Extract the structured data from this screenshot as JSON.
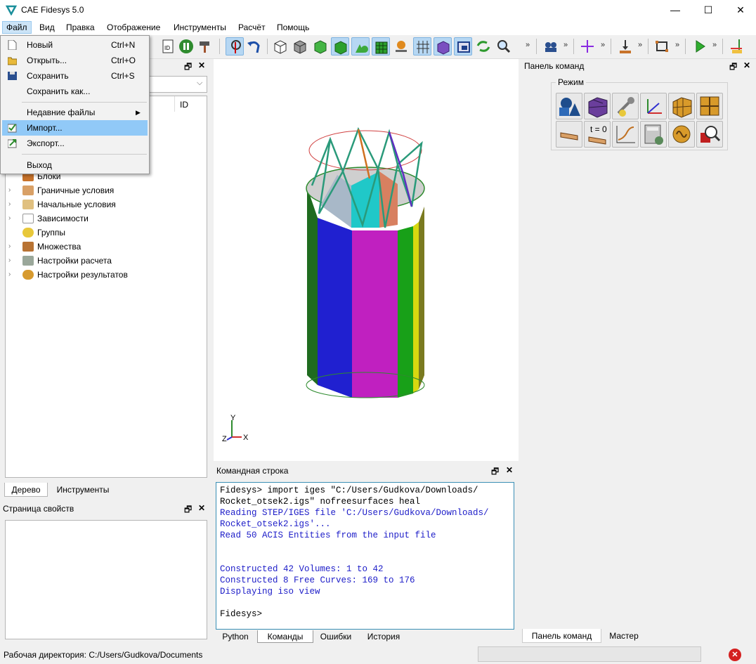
{
  "window": {
    "title": "CAE Fidesys 5.0"
  },
  "menu": [
    "Файл",
    "Вид",
    "Правка",
    "Отображение",
    "Инструменты",
    "Расчёт",
    "Помощь"
  ],
  "file_menu": {
    "items": [
      {
        "label": "Новый",
        "shortcut": "Ctrl+N"
      },
      {
        "label": "Открыть...",
        "shortcut": "Ctrl+O"
      },
      {
        "label": "Сохранить",
        "shortcut": "Ctrl+S"
      },
      {
        "label": "Сохранить как...",
        "shortcut": ""
      },
      {
        "label": "Недавние файлы",
        "shortcut": ""
      },
      {
        "label": "Импорт...",
        "shortcut": ""
      },
      {
        "label": "Экспорт...",
        "shortcut": ""
      },
      {
        "label": "Выход",
        "shortcut": ""
      }
    ],
    "highlighted": "Импорт..."
  },
  "tree": {
    "column_id": "ID",
    "items": [
      "Блоки",
      "Граничные условия",
      "Начальные условия",
      "Зависимости",
      "Группы",
      "Множества",
      "Настройки расчета",
      "Настройки результатов"
    ],
    "bottom_tabs": [
      "Дерево",
      "Инструменты"
    ]
  },
  "properties": {
    "title": "Страница свойств"
  },
  "command_panel": {
    "title": "Панель команд",
    "mode_label": "Режим",
    "t0_label": "t = 0",
    "bottom_tabs": [
      "Панель команд",
      "Мастер"
    ]
  },
  "command_line": {
    "title": "Командная строка",
    "lines": [
      {
        "text": "Fidesys> import iges \"C:/Users/Gudkova/Downloads/",
        "style": "blk"
      },
      {
        "text": "Rocket_otsek2.igs\" nofreesurfaces heal",
        "style": "blk"
      },
      {
        "text": "Reading STEP/IGES file 'C:/Users/Gudkova/Downloads/",
        "style": "blu"
      },
      {
        "text": "Rocket_otsek2.igs'...",
        "style": "blu"
      },
      {
        "text": "Read 50 ACIS Entities from the input file",
        "style": "blu"
      },
      {
        "text": "",
        "style": "blu"
      },
      {
        "text": "",
        "style": "blu"
      },
      {
        "text": "Constructed 42 Volumes: 1 to 42",
        "style": "blu"
      },
      {
        "text": "Constructed 8 Free Curves: 169 to 176",
        "style": "blu"
      },
      {
        "text": "Displaying iso view",
        "style": "blu"
      },
      {
        "text": "",
        "style": "blu"
      },
      {
        "text": "Fidesys>",
        "style": "blk"
      }
    ],
    "tabs": [
      "Python",
      "Команды",
      "Ошибки",
      "История"
    ],
    "active_tab": "Команды"
  },
  "viewport": {
    "axes": {
      "y": "Y",
      "x": "X",
      "z": "Z"
    }
  },
  "status": {
    "workdir": "Рабочая директория: C:/Users/Gudkova/Documents"
  },
  "colors": {
    "accent": "#91c9f7",
    "cmd_blue": "#1c1cc8"
  }
}
